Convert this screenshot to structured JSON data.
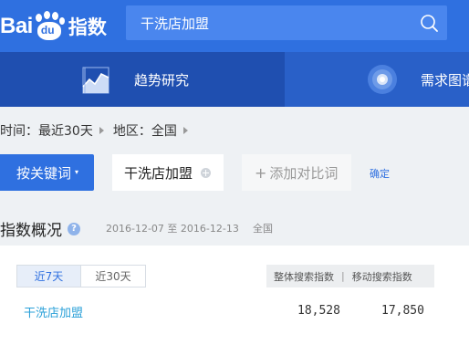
{
  "header": {
    "logo_bai": "Bai",
    "logo_du": "du",
    "logo_zhishu": "指数",
    "search_value": "干洗店加盟"
  },
  "nav": {
    "tabs": [
      {
        "label": "趋势研究",
        "active": true
      },
      {
        "label": "需求图谱",
        "active": false
      }
    ]
  },
  "filter": {
    "time": "时间：最近30天",
    "region": "地区：全国"
  },
  "keywords": {
    "button_label": "按关键词",
    "caret": "▾",
    "tag": "干洗店加盟",
    "add_compare": "添加对比词",
    "confirm": "确定"
  },
  "overview": {
    "title": "指数概况",
    "help": "?",
    "date_range": "2016-12-07 至 2016-12-13",
    "region": "全国",
    "segments": [
      "近7天",
      "近30天"
    ],
    "selected_segment": "近7天",
    "columns": [
      "整体搜索指数",
      "移动搜索指数"
    ],
    "column_separator": "|",
    "rows": [
      {
        "keyword": "干洗店加盟",
        "overall": "18,528",
        "mobile": "17,850"
      }
    ]
  },
  "colors": {
    "brand_blue": "#2f70e0",
    "nav_active": "#1f4fb0",
    "link": "#2aa0d8"
  }
}
